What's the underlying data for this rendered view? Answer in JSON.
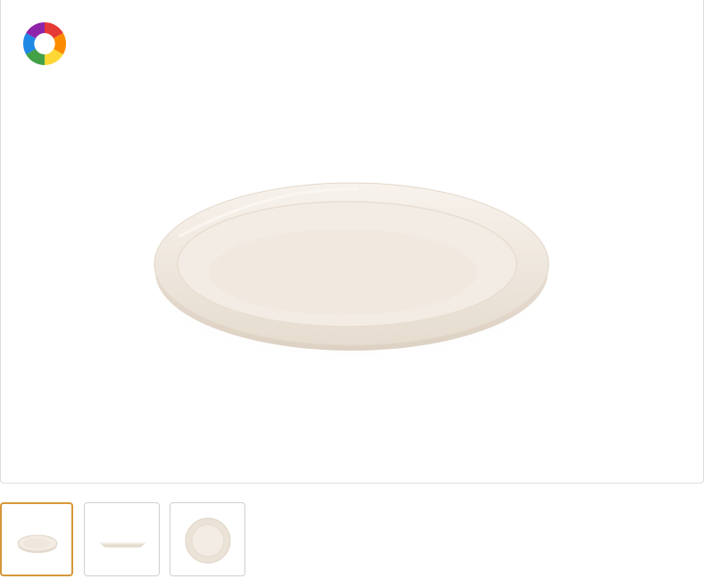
{
  "gallery": {
    "brand_logo": {
      "icon": "rainbow-swirl-logo-icon",
      "colors": [
        "#e53935",
        "#fb8c00",
        "#fdd835",
        "#43a047",
        "#1e88e5",
        "#8e24aa"
      ]
    },
    "product_color": "#f2ebe3",
    "accent_color": "#d79637",
    "selected_index": 0,
    "thumbnails": [
      {
        "view": "angled-plate-icon"
      },
      {
        "view": "side-plate-icon"
      },
      {
        "view": "top-plate-icon"
      }
    ]
  }
}
